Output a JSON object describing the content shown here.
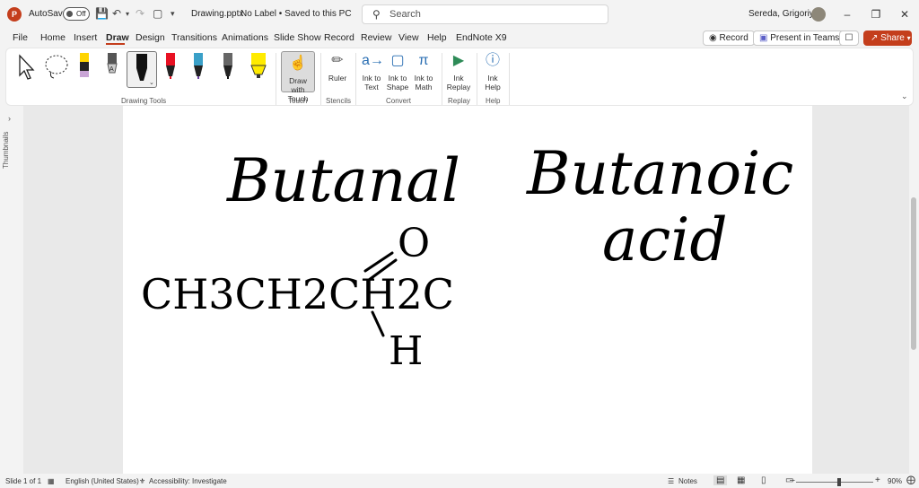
{
  "titlebar": {
    "autosave_label": "AutoSave",
    "autosave_state": "Off",
    "file_name": "Drawing.pptx",
    "label_status": "No Label • Saved to this PC",
    "search_placeholder": "Search",
    "user_name": "Sereda, Grigoriy A"
  },
  "menu": {
    "file": "File",
    "home": "Home",
    "insert": "Insert",
    "draw": "Draw",
    "design": "Design",
    "transitions": "Transitions",
    "animations": "Animations",
    "slideshow": "Slide Show",
    "record": "Record",
    "review": "Review",
    "view": "View",
    "help": "Help",
    "endnote": "EndNote X9"
  },
  "actions": {
    "record": "Record",
    "present_teams": "Present in Teams",
    "share": "Share"
  },
  "ribbon": {
    "drawing_tools": "Drawing Tools",
    "draw_with_touch": "Draw with Touch",
    "touch": "Touch",
    "ruler": "Ruler",
    "stencils": "Stencils",
    "ink_to_text": "Ink to Text",
    "ink_to_shape": "Ink to Shape",
    "ink_to_math": "Ink to Math",
    "convert": "Convert",
    "ink_replay": "Ink Replay",
    "replay": "Replay",
    "ink_help": "Ink Help",
    "help": "Help"
  },
  "sidepanel": {
    "thumbnails": "Thumbnails"
  },
  "slide": {
    "ink_word_1": "Butanal",
    "ink_word_2": "Butanoic",
    "ink_word_3": "acid",
    "ink_formula": "CH3CH2CH2C",
    "ink_o": "O",
    "ink_h": "H"
  },
  "status": {
    "slide": "Slide 1 of 1",
    "language": "English (United States)",
    "accessibility": "Accessibility: Investigate",
    "notes": "Notes",
    "zoom": "90%"
  },
  "colors": {
    "accent": "#c43e1c",
    "pen_black": "#000000",
    "pen_red": "#e81123",
    "pen_yellow": "#ffeb00"
  }
}
